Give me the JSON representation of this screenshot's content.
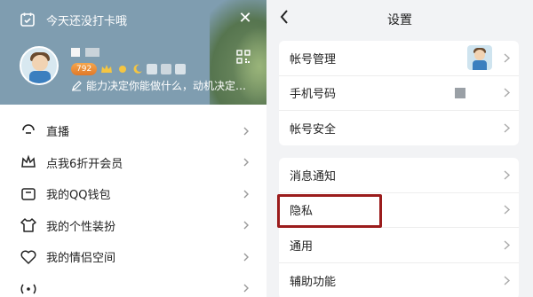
{
  "left_panel": {
    "checkin": {
      "text": "今天还没打卡哦",
      "icon": "calendar-check-icon",
      "close_icon": "close-icon"
    },
    "profile": {
      "level": "792",
      "signature": "能力决定你能做什么，动机决定…",
      "qr_icon": "qr-code-icon"
    },
    "menu": [
      {
        "label": "直播",
        "icon": "live-icon"
      },
      {
        "label": "点我6折开会员",
        "icon": "crown-icon"
      },
      {
        "label": "我的QQ钱包",
        "icon": "wallet-icon"
      },
      {
        "label": "我的个性装扮",
        "icon": "shirt-icon"
      },
      {
        "label": "我的情侣空间",
        "icon": "heart-icon"
      },
      {
        "label": "",
        "icon": "signal-icon"
      }
    ]
  },
  "right_panel": {
    "title": "设置",
    "back_icon": "back-arrow-icon",
    "group1": [
      {
        "label": "帐号管理"
      },
      {
        "label": "手机号码"
      },
      {
        "label": "帐号安全"
      }
    ],
    "group2": [
      {
        "label": "消息通知"
      },
      {
        "label": "隐私"
      },
      {
        "label": "通用"
      },
      {
        "label": "辅助功能"
      }
    ]
  },
  "colors": {
    "header_bg": "#7f9db0",
    "highlight": "#9b1c1c",
    "settings_bg": "#f2f3f5"
  }
}
